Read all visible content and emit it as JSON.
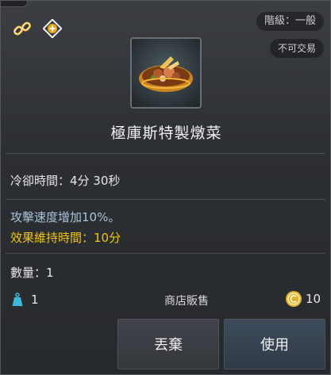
{
  "header": {
    "grade_label": "階級：一般",
    "trade_label": "不可交易",
    "icons": [
      "link-icon",
      "plus-circle-icon"
    ]
  },
  "item": {
    "icon": "stew-plate-icon",
    "name": "極庫斯特製燉菜"
  },
  "stats": {
    "cooldown": "冷卻時間：4分 30秒",
    "effect_line1": "攻擊速度增加10%。",
    "effect_line2": "效果維持時間：10分"
  },
  "footer": {
    "quantity": "數量：1",
    "weight_value": "1",
    "shop_label": "商店販售",
    "price_value": "10"
  },
  "buttons": {
    "discard": "丟棄",
    "use": "使用"
  },
  "colors": {
    "effect_blue": "#a9c4d6",
    "effect_gold": "#f0c419",
    "weight_teal": "#3fb7d8",
    "coin_gold": "#e0b131"
  }
}
